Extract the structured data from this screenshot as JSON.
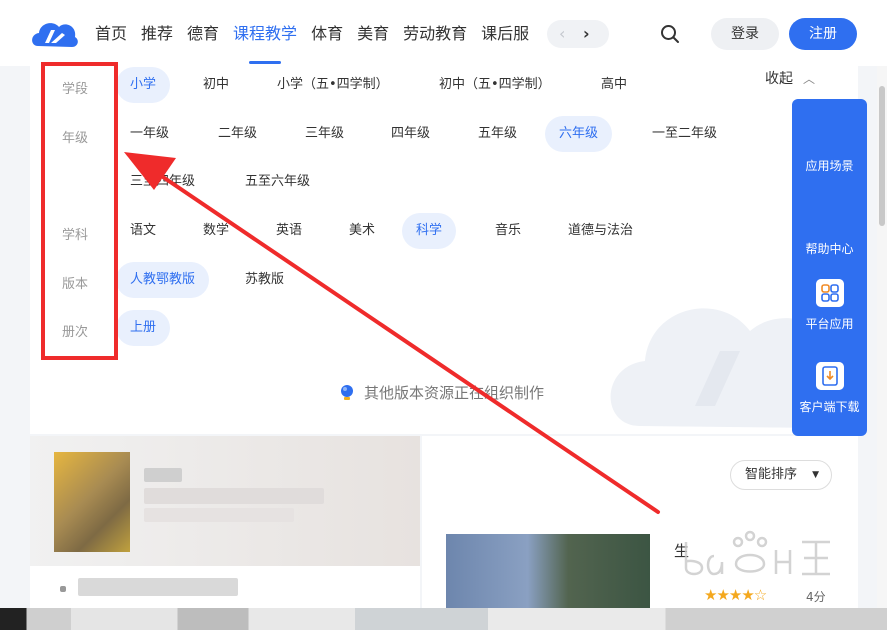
{
  "header": {
    "nav_items": [
      "首页",
      "推荐",
      "德育",
      "课程教学",
      "体育",
      "美育",
      "劳动教育",
      "课后服"
    ],
    "active_nav": "课程教学",
    "arrow_left": "‹",
    "arrow_right": "›",
    "login_label": "登录",
    "register_label": "注册"
  },
  "filters": {
    "collapse_label": "收起",
    "rows": [
      {
        "label": "学段",
        "options": [
          "小学",
          "初中",
          "小学（五•四学制）",
          "初中（五•四学制）",
          "高中"
        ],
        "selected": "小学"
      },
      {
        "label": "年级",
        "options": [
          "一年级",
          "二年级",
          "三年级",
          "四年级",
          "五年级",
          "六年级",
          "一至二年级",
          "三至四年级",
          "五至六年级"
        ],
        "selected": "六年级"
      },
      {
        "label": "学科",
        "options": [
          "语文",
          "数学",
          "英语",
          "美术",
          "科学",
          "音乐",
          "道德与法治"
        ],
        "selected": "科学"
      },
      {
        "label": "版本",
        "options": [
          "人教鄂教版",
          "苏教版"
        ],
        "selected": "人教鄂教版"
      },
      {
        "label": "册次",
        "options": [
          "上册"
        ],
        "selected": "上册"
      }
    ],
    "notice": "其他版本资源正在组织制作"
  },
  "side_toolbar": {
    "items": [
      "应用场景",
      "帮助中心",
      "平台应用",
      "客户端下载"
    ]
  },
  "content": {
    "sort_label": "智能排序",
    "video_title_partial": "生",
    "rating_stars": "★★★★☆",
    "score": "4分"
  },
  "colors": {
    "brand": "#2f6ff0",
    "selected_bg": "#e9f0fd",
    "annotation_red": "#ef2b2b"
  }
}
